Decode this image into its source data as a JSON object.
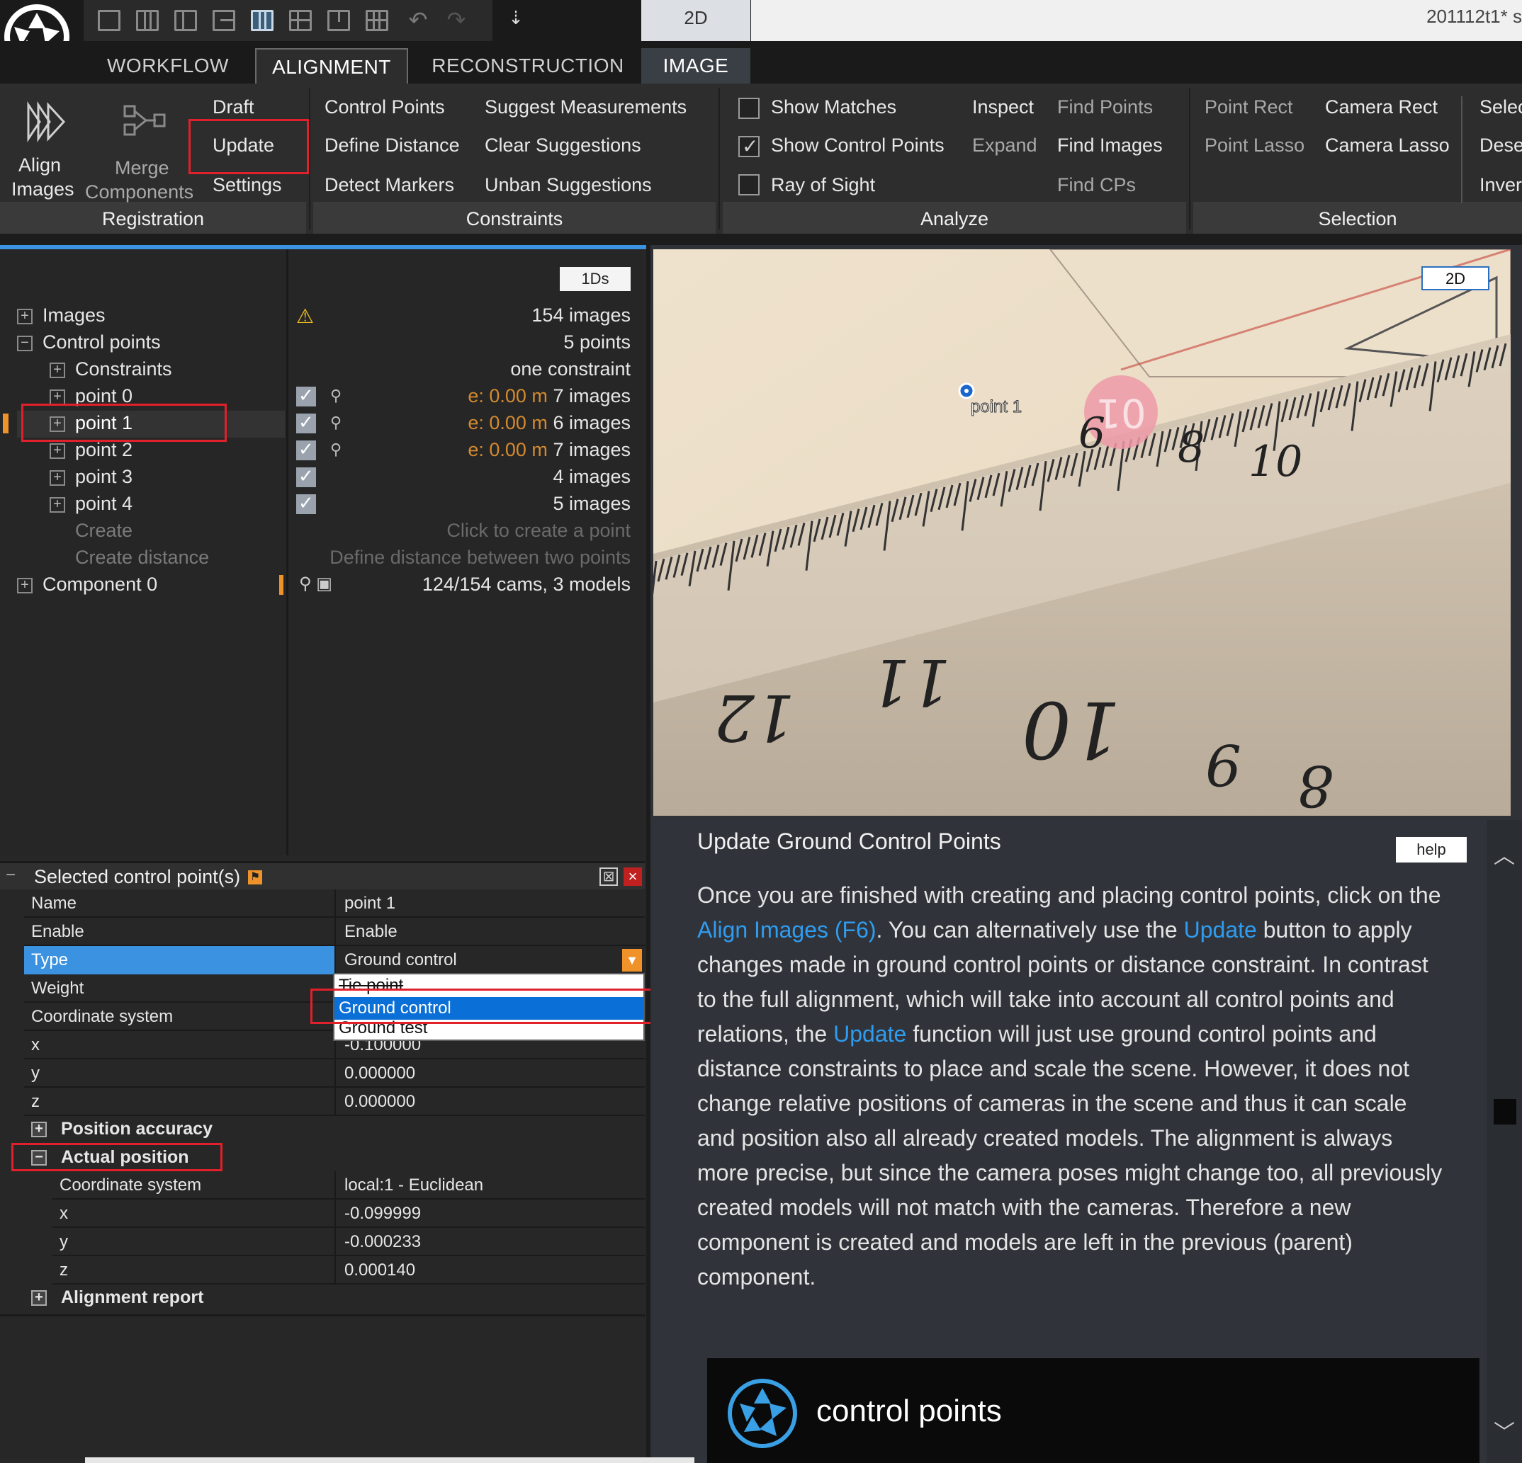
{
  "window": {
    "title": "201112t1* s",
    "view_tab": "2D"
  },
  "tabs": [
    "WORKFLOW",
    "ALIGNMENT",
    "RECONSTRUCTION",
    "IMAGE"
  ],
  "ribbon": {
    "registration": {
      "title": "Registration",
      "align_line1": "Align",
      "align_line2": "Images",
      "merge_line1": "Merge",
      "merge_line2": "Components",
      "draft": "Draft",
      "update": "Update",
      "settings": "Settings"
    },
    "constraints": {
      "title": "Constraints",
      "control_points": "Control Points",
      "define_distance": "Define Distance",
      "detect_markers": "Detect Markers",
      "suggest_measurements": "Suggest Measurements",
      "clear_suggestions": "Clear Suggestions",
      "unban_suggestions": "Unban Suggestions"
    },
    "analyze": {
      "title": "Analyze",
      "show_matches": "Show Matches",
      "show_control_points": "Show Control Points",
      "ray_of_sight": "Ray of Sight",
      "inspect": "Inspect",
      "expand": "Expand",
      "find_points": "Find Points",
      "find_images": "Find Images",
      "find_cps": "Find CPs"
    },
    "selection": {
      "title": "Selection",
      "point_rect": "Point Rect",
      "point_lasso": "Point Lasso",
      "camera_rect": "Camera Rect",
      "camera_lasso": "Camera Lasso",
      "select": "Selec",
      "deselect": "Dese",
      "invert": "Inver"
    }
  },
  "tree": {
    "images": "Images",
    "control_points": "Control points",
    "constraints": "Constraints",
    "points": [
      "point 0",
      "point 1",
      "point 2",
      "point 3",
      "point 4"
    ],
    "create": "Create",
    "create_distance": "Create distance",
    "component": "Component 0"
  },
  "info": {
    "button": "1Ds",
    "images": "154 images",
    "points": "5 points",
    "constraint": "one constraint",
    "err": "e: 0.00 m",
    "point_images": [
      "7 images",
      "6 images",
      "7 images",
      "4 images",
      "5 images"
    ],
    "create_hint": "Click to create a point",
    "distance_hint": "Define distance between two points",
    "component": "124/154 cams, 3 models"
  },
  "props": {
    "header": "Selected control point(s)",
    "rows": {
      "name_k": "Name",
      "name_v": "point 1",
      "enable_k": "Enable",
      "enable_v": "Enable",
      "type_k": "Type",
      "type_v": "Ground control",
      "weight_k": "Weight",
      "coord_k": "Coordinate system",
      "x_k": "x",
      "x_v": "-0.100000",
      "y_k": "y",
      "y_v": "0.000000",
      "z_k": "z",
      "z_v": "0.000000"
    },
    "dropdown": [
      "Tie point",
      "Ground control",
      "Ground test"
    ],
    "position_accuracy": "Position accuracy",
    "actual_position": "Actual position",
    "actual": {
      "coord_k": "Coordinate system",
      "coord_v": "local:1 - Euclidean",
      "x_k": "x",
      "x_v": "-0.099999",
      "y_k": "y",
      "y_v": "-0.000233",
      "z_k": "z",
      "z_v": "0.000140"
    },
    "alignment_report": "Alignment report"
  },
  "viewer": {
    "mode": "2D",
    "point_label": "point 1"
  },
  "help": {
    "title": "Update Ground Control Points",
    "button": "help",
    "p1": "Once you are finished with creating and placing control points, click on the ",
    "link1": "Align Images (F6)",
    "p2": ". You can alternatively use the ",
    "link2": "Update",
    "p3": " button to apply changes made in ground control points or distance constraint. In contrast to the full alignment, which will take into account all control points and relations, the ",
    "link3": "Update",
    "p4": " function will just use ground control points and distance constraints to place and scale the scene. However, it does not change relative positions of cameras in the scene and thus it can scale and position also all already created models. The alignment is always more precise, but since the camera poses might change too, all previously created models will not match with the cameras. Therefore a new component is created and models are left in the previous (parent) component.",
    "video_title": "control points"
  },
  "colors": {
    "accent_blue": "#3a92e0",
    "highlight_red": "#e0202a",
    "link": "#2f9cf0",
    "warning": "#f0c020",
    "error_orange": "#d48a2e"
  }
}
